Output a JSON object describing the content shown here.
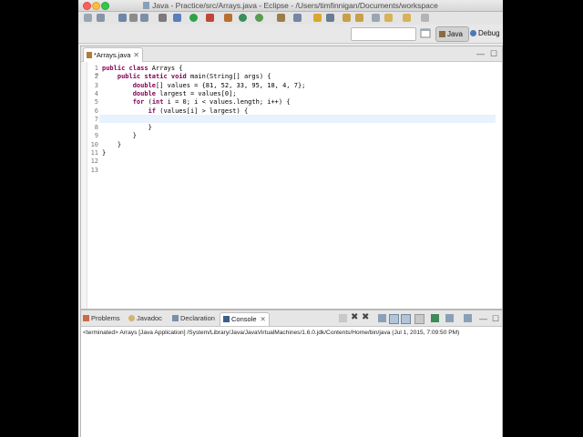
{
  "window": {
    "title": "Java - Practice/src/Arrays.java - Eclipse - /Users/timfinnigan/Documents/workspace"
  },
  "perspectives": {
    "java": "Java",
    "debug": "Debug"
  },
  "quick_access": {
    "placeholder": ""
  },
  "editor": {
    "tab_label": "*Arrays.java",
    "line_numbers": [
      "1",
      "2",
      "3",
      "4",
      "5",
      "6",
      "7",
      "8",
      "9",
      "10",
      "11",
      "12",
      "13"
    ],
    "lines": [
      "public class Arrays {",
      "    public static void main(String[] args) {",
      "        double[] values = {81, 52, 33, 95, 18, 4, 7};",
      "        double largest = values[0];",
      "        for (int i = 0; i < values.length; i++) {",
      "            if (values[i] > largest) {",
      "",
      "            }",
      "        }",
      "    }",
      "}",
      "",
      ""
    ]
  },
  "bottom_tabs": {
    "problems": "Problems",
    "javadoc": "Javadoc",
    "declaration": "Declaration",
    "console": "Console"
  },
  "console": {
    "status": "<terminated> Arrays [Java Application] /System/Library/Java/JavaVirtualMachines/1.6.0.jdk/Contents/Home/bin/java (Jul 1, 2015, 7:09:50 PM)"
  },
  "colors": {
    "keyword": "#7f0055",
    "current_line": "#e8f2fe"
  }
}
